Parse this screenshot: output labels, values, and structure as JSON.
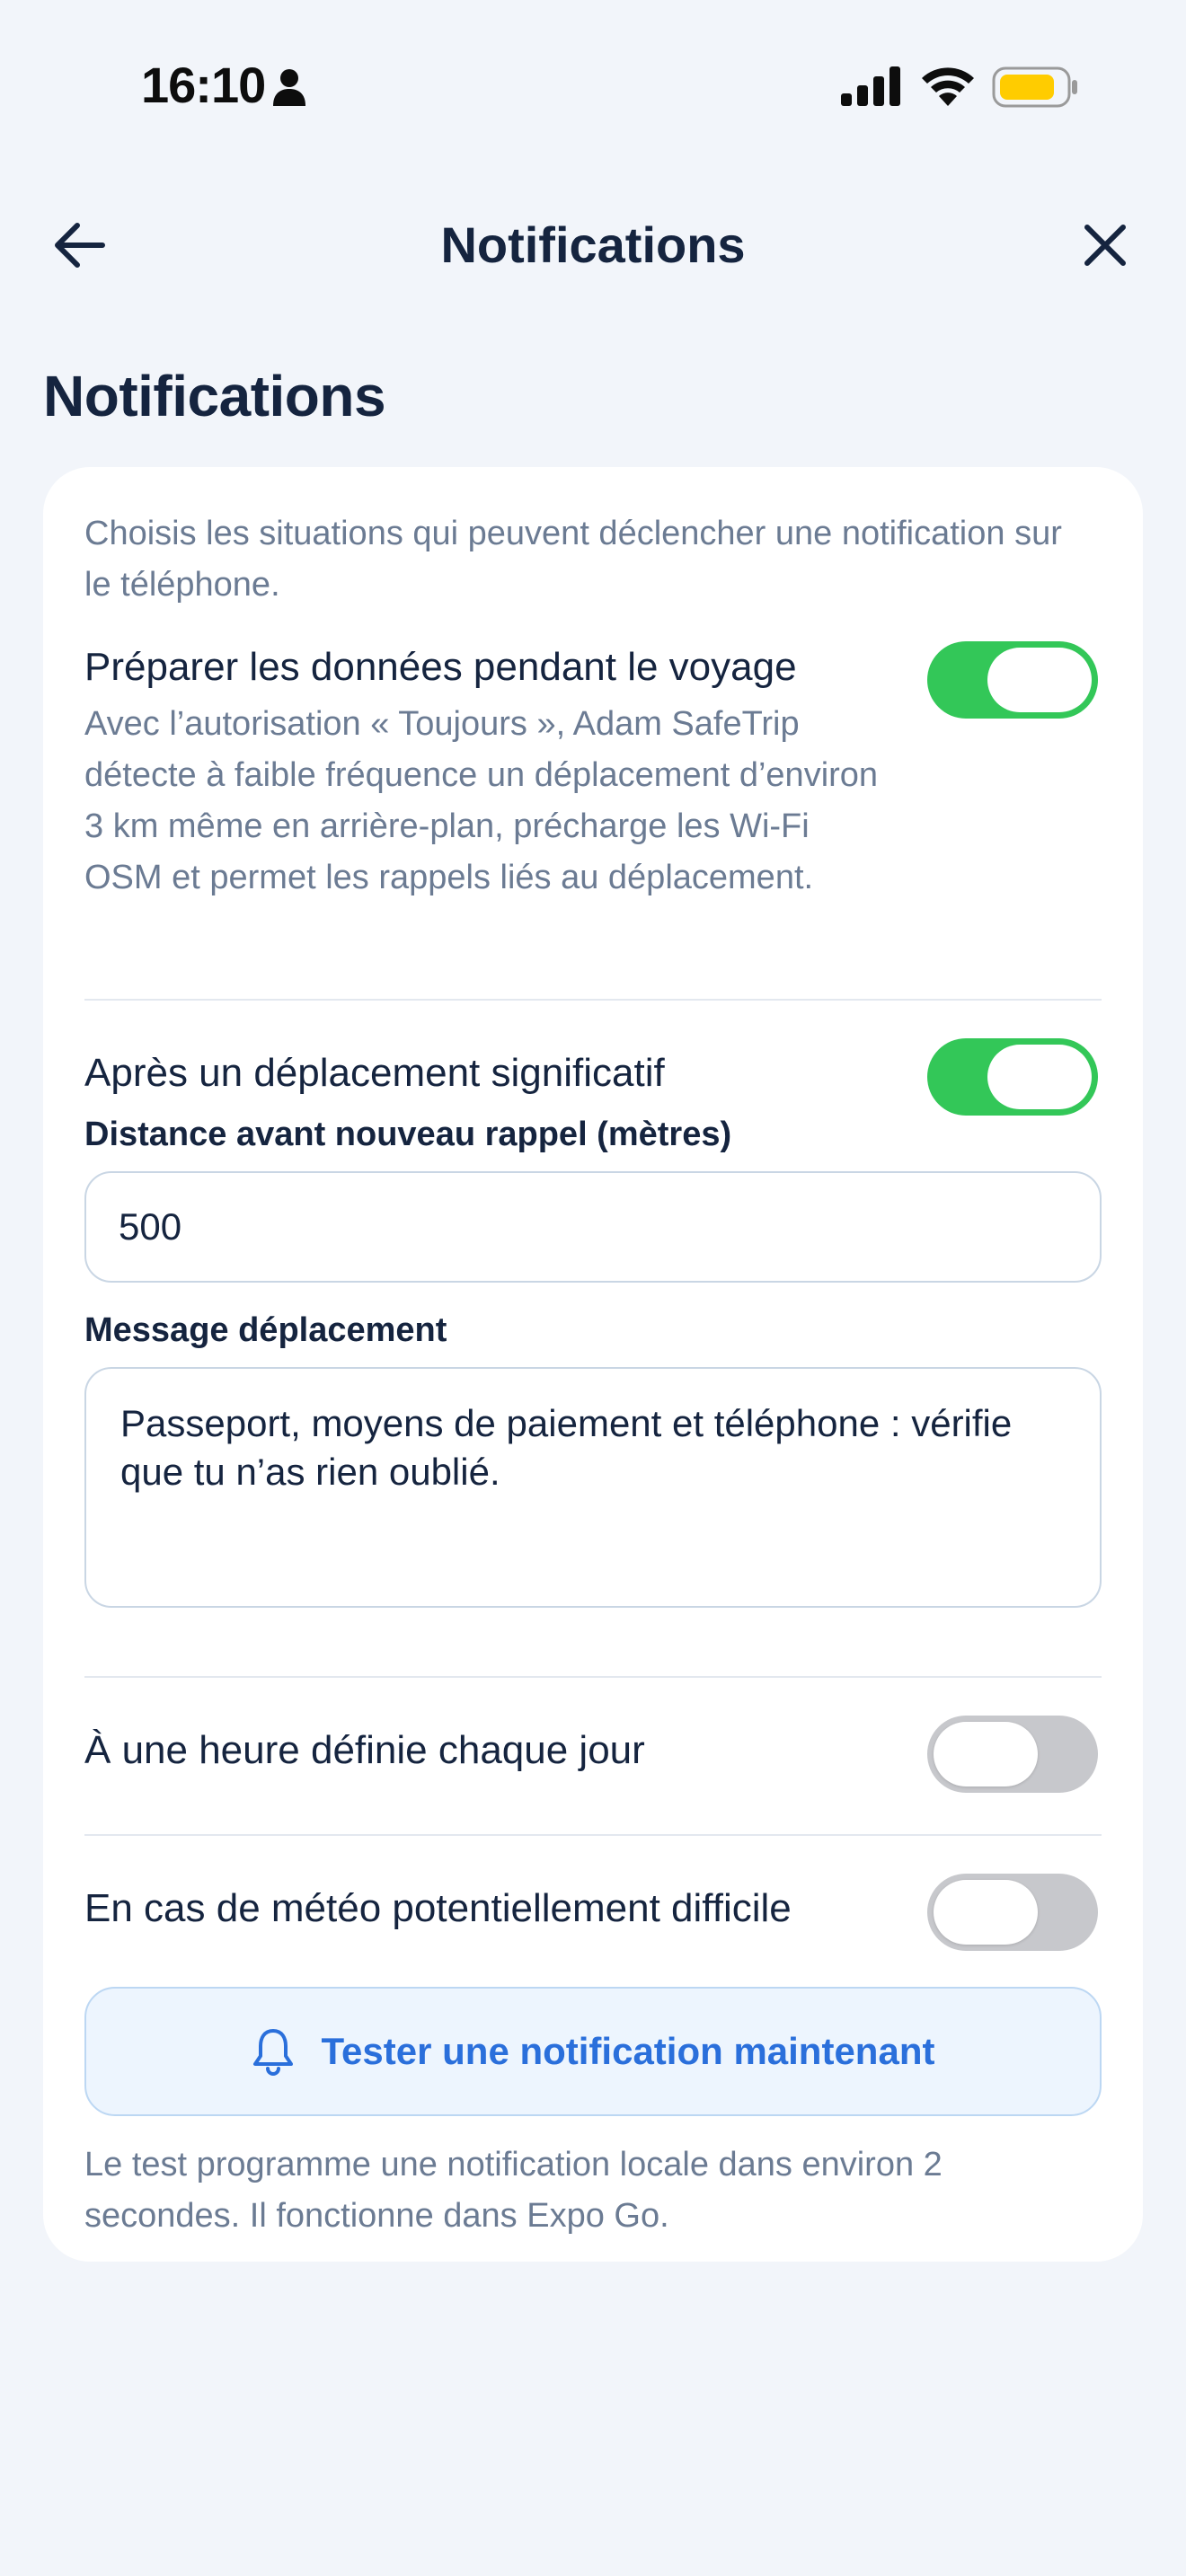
{
  "status_bar": {
    "time": "16:10",
    "icons": [
      "person-icon",
      "signal-icon",
      "wifi-icon",
      "battery-icon"
    ],
    "battery_color": "#ffcc00"
  },
  "header": {
    "title": "Notifications",
    "back_icon": "arrow-left-icon",
    "close_icon": "close-icon"
  },
  "page_title": "Notifications",
  "card": {
    "intro": "Choisis les situations qui peuvent déclencher une notification sur le téléphone.",
    "travel_prep": {
      "title": "Préparer les données pendant le voyage",
      "description": "Avec l’autorisation « Toujours », Adam SafeTrip détecte à faible fréquence un déplacement d’environ 3 km même en arrière-plan, précharge les Wi-Fi OSM et permet les rappels liés au déplacement.",
      "enabled": true
    },
    "significant_move": {
      "title": "Après un déplacement significatif",
      "enabled": true,
      "distance_label": "Distance avant nouveau rappel (mètres)",
      "distance_value": "500",
      "message_label": "Message déplacement",
      "message_value": "Passeport, moyens de paiement et téléphone : vérifie que tu n’as rien oublié."
    },
    "daily_time": {
      "title": "À une heure définie chaque jour",
      "enabled": false
    },
    "bad_weather": {
      "title": "En cas de météo potentiellement difficile",
      "enabled": false
    },
    "test_button": {
      "label": "Tester une notification maintenant",
      "icon": "bell-icon"
    },
    "footnote": "Le test programme une notification locale dans environ 2 secondes. Il fonctionne dans Expo Go."
  },
  "colors": {
    "background": "#f2f5fa",
    "toggle_on": "#33c758",
    "toggle_off": "#c7c8cc",
    "accent": "#2a6fdb",
    "text_primary": "#15243f",
    "text_secondary": "#6b7b93"
  }
}
